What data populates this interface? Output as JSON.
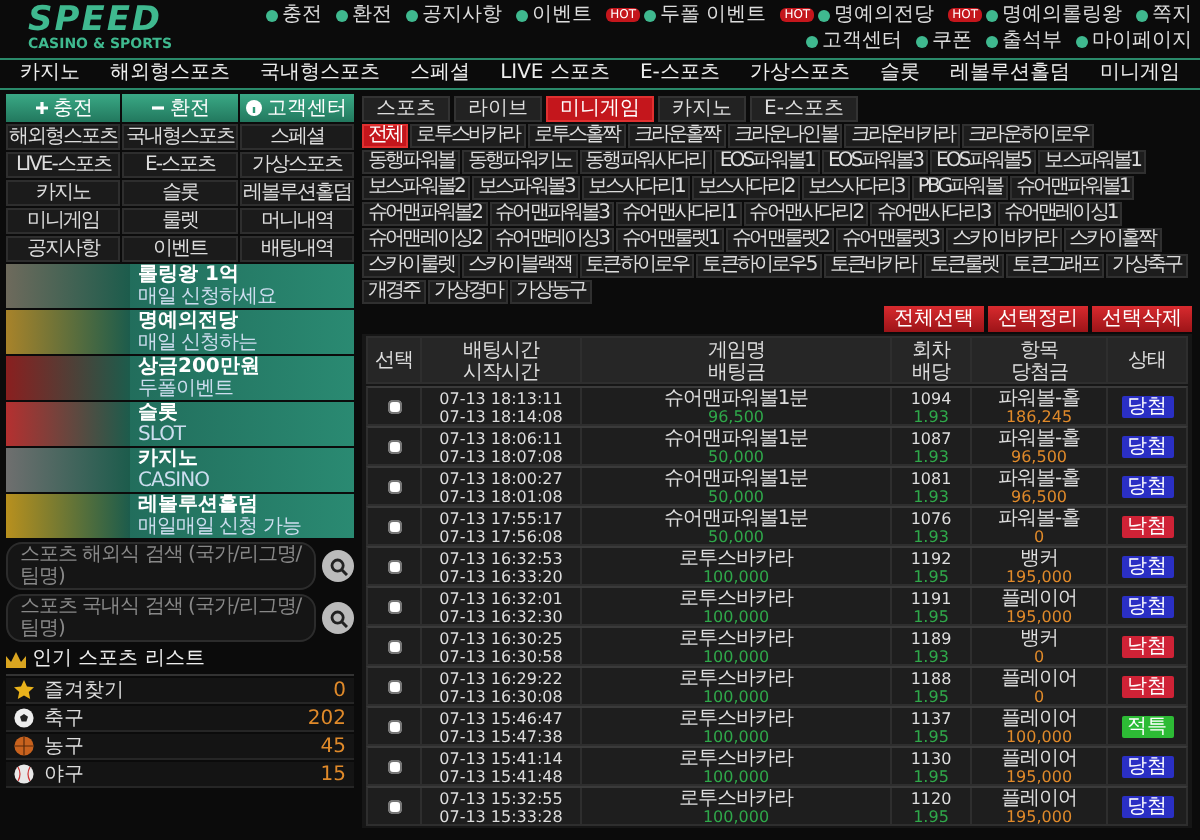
{
  "logo": {
    "title": "SPEED",
    "subtitle": "CASINO & SPORTS"
  },
  "top_links": [
    {
      "label": "충전"
    },
    {
      "label": "환전"
    },
    {
      "label": "공지사항"
    },
    {
      "label": "이벤트"
    },
    {
      "label": "두폴 이벤트",
      "badge": "HOT"
    },
    {
      "label": "명예의전당",
      "badge": "HOT"
    },
    {
      "label": "명예의롤링왕",
      "badge": "HOT"
    },
    {
      "label": "쪽지"
    },
    {
      "label": "고객센터"
    },
    {
      "label": "쿠폰"
    },
    {
      "label": "출석부"
    },
    {
      "label": "마이페이지"
    }
  ],
  "main_nav": [
    "카지노",
    "해외형스포츠",
    "국내형스포츠",
    "스페셜",
    "LIVE 스포츠",
    "E-스포츠",
    "가상스포츠",
    "슬롯",
    "레볼루션홀덤",
    "미니게임"
  ],
  "sidebar": {
    "quick_buttons": [
      "충전",
      "환전",
      "고객센터"
    ],
    "menu": [
      "해외형스포츠",
      "국내형스포츠",
      "스페셜",
      "LIVE-스포츠",
      "E-스포츠",
      "가상스포츠",
      "카지노",
      "슬롯",
      "레볼루션홀덤",
      "미니게임",
      "룰렛",
      "머니내역",
      "공지사항",
      "이벤트",
      "배팅내역"
    ],
    "banners": [
      {
        "title": "롤링왕 1억",
        "subtitle": "매일 신청하세요"
      },
      {
        "title": "명예의전당",
        "subtitle": "매일 신청하는"
      },
      {
        "title": "상금200만원",
        "subtitle": "두폴이벤트"
      },
      {
        "title": "슬롯",
        "subtitle": "SLOT"
      },
      {
        "title": "카지노",
        "subtitle": "CASINO"
      },
      {
        "title": "레볼루션홀덤",
        "subtitle": "매일매일 신청 가능"
      }
    ],
    "searches": [
      {
        "placeholder": "스포츠 해외식 검색 (국가/리그명/팀명)"
      },
      {
        "placeholder": "스포츠 국내식 검색 (국가/리그명/팀명)"
      }
    ],
    "popular": {
      "title": "인기 스포츠 리스트",
      "items": [
        {
          "kind": "favorites",
          "name": "즐겨찾기",
          "count": "0"
        },
        {
          "kind": "soccer",
          "name": "축구",
          "count": "202"
        },
        {
          "kind": "basketball",
          "name": "농구",
          "count": "45"
        },
        {
          "kind": "baseball",
          "name": "야구",
          "count": "15"
        }
      ]
    }
  },
  "category_tabs": [
    {
      "label": "스포츠",
      "selected": false
    },
    {
      "label": "라이브",
      "selected": false
    },
    {
      "label": "미니게임",
      "selected": true
    },
    {
      "label": "카지노",
      "selected": false
    },
    {
      "label": "E-스포츠",
      "selected": false
    }
  ],
  "game_filters": [
    {
      "label": "전체",
      "selected": true
    },
    {
      "label": "로투스바카라",
      "selected": false
    },
    {
      "label": "로투스홀짝",
      "selected": false
    },
    {
      "label": "크라운홀짝",
      "selected": false
    },
    {
      "label": "크라운나인볼",
      "selected": false
    },
    {
      "label": "크라운바카라",
      "selected": false
    },
    {
      "label": "크라운하이로우",
      "selected": false
    },
    {
      "label": "동행파워볼",
      "selected": false
    },
    {
      "label": "동행파워키노",
      "selected": false
    },
    {
      "label": "동행파워사다리",
      "selected": false
    },
    {
      "label": "EOS파워볼1",
      "selected": false
    },
    {
      "label": "EOS파워볼3",
      "selected": false
    },
    {
      "label": "EOS파워볼5",
      "selected": false
    },
    {
      "label": "보스파워볼1",
      "selected": false
    },
    {
      "label": "보스파워볼2",
      "selected": false
    },
    {
      "label": "보스파워볼3",
      "selected": false
    },
    {
      "label": "보스사다리1",
      "selected": false
    },
    {
      "label": "보스사다리2",
      "selected": false
    },
    {
      "label": "보스사다리3",
      "selected": false
    },
    {
      "label": "PBG파워볼",
      "selected": false
    },
    {
      "label": "슈어맨파워볼1",
      "selected": false
    },
    {
      "label": "슈어맨파워볼2",
      "selected": false
    },
    {
      "label": "슈어맨파워볼3",
      "selected": false
    },
    {
      "label": "슈어맨사다리1",
      "selected": false
    },
    {
      "label": "슈어맨사다리2",
      "selected": false
    },
    {
      "label": "슈어맨사다리3",
      "selected": false
    },
    {
      "label": "슈어맨레이싱1",
      "selected": false
    },
    {
      "label": "슈어맨레이싱2",
      "selected": false
    },
    {
      "label": "슈어맨레이싱3",
      "selected": false
    },
    {
      "label": "슈어맨룰렛1",
      "selected": false
    },
    {
      "label": "슈어맨룰렛2",
      "selected": false
    },
    {
      "label": "슈어맨룰렛3",
      "selected": false
    },
    {
      "label": "스카이바카라",
      "selected": false
    },
    {
      "label": "스카이홀짝",
      "selected": false
    },
    {
      "label": "스카이룰렛",
      "selected": false
    },
    {
      "label": "스카이블랙잭",
      "selected": false
    },
    {
      "label": "토큰하이로우",
      "selected": false
    },
    {
      "label": "토큰하이로우5",
      "selected": false
    },
    {
      "label": "토큰바카라",
      "selected": false
    },
    {
      "label": "토큰룰렛",
      "selected": false
    },
    {
      "label": "토큰그래프",
      "selected": false
    },
    {
      "label": "가상축구",
      "selected": false
    },
    {
      "label": "개경주",
      "selected": false
    },
    {
      "label": "가상경마",
      "selected": false
    },
    {
      "label": "가상농구",
      "selected": false
    }
  ],
  "actions": [
    "전체선택",
    "선택정리",
    "선택삭제"
  ],
  "table": {
    "columns": [
      {
        "labels": [
          "선택"
        ]
      },
      {
        "labels": [
          "배팅시간",
          "시작시간"
        ]
      },
      {
        "labels": [
          "게임명",
          "배팅금"
        ]
      },
      {
        "labels": [
          "회차",
          "배당"
        ]
      },
      {
        "labels": [
          "항목",
          "당첨금"
        ]
      },
      {
        "labels": [
          "상태"
        ]
      }
    ],
    "rows": [
      {
        "checked": false,
        "bet_time": "07-13 18:13:11",
        "start_time": "07-13 18:14:08",
        "game": "슈어맨파워볼1분",
        "stake": "96,500",
        "round": "1094",
        "odds": "1.93",
        "pick": "파워볼-홀",
        "payout": "186,245",
        "status": {
          "label": "당첨",
          "color": "#2a2fc4"
        }
      },
      {
        "checked": false,
        "bet_time": "07-13 18:06:11",
        "start_time": "07-13 18:07:08",
        "game": "슈어맨파워볼1분",
        "stake": "50,000",
        "round": "1087",
        "odds": "1.93",
        "pick": "파워볼-홀",
        "payout": "96,500",
        "status": {
          "label": "당첨",
          "color": "#2a2fc4"
        }
      },
      {
        "checked": false,
        "bet_time": "07-13 18:00:27",
        "start_time": "07-13 18:01:08",
        "game": "슈어맨파워볼1분",
        "stake": "50,000",
        "round": "1081",
        "odds": "1.93",
        "pick": "파워볼-홀",
        "payout": "96,500",
        "status": {
          "label": "당첨",
          "color": "#2a2fc4"
        }
      },
      {
        "checked": false,
        "bet_time": "07-13 17:55:17",
        "start_time": "07-13 17:56:08",
        "game": "슈어맨파워볼1분",
        "stake": "50,000",
        "round": "1076",
        "odds": "1.93",
        "pick": "파워볼-홀",
        "payout": "0",
        "status": {
          "label": "낙첨",
          "color": "#cf2236"
        }
      },
      {
        "checked": false,
        "bet_time": "07-13 16:32:53",
        "start_time": "07-13 16:33:20",
        "game": "로투스바카라",
        "stake": "100,000",
        "round": "1192",
        "odds": "1.95",
        "pick": "뱅커",
        "payout": "195,000",
        "status": {
          "label": "당첨",
          "color": "#2a2fc4"
        }
      },
      {
        "checked": false,
        "bet_time": "07-13 16:32:01",
        "start_time": "07-13 16:32:30",
        "game": "로투스바카라",
        "stake": "100,000",
        "round": "1191",
        "odds": "1.95",
        "pick": "플레이어",
        "payout": "195,000",
        "status": {
          "label": "당첨",
          "color": "#2a2fc4"
        }
      },
      {
        "checked": false,
        "bet_time": "07-13 16:30:25",
        "start_time": "07-13 16:30:58",
        "game": "로투스바카라",
        "stake": "100,000",
        "round": "1189",
        "odds": "1.93",
        "pick": "뱅커",
        "payout": "0",
        "status": {
          "label": "낙첨",
          "color": "#cf2236"
        }
      },
      {
        "checked": false,
        "bet_time": "07-13 16:29:22",
        "start_time": "07-13 16:30:08",
        "game": "로투스바카라",
        "stake": "100,000",
        "round": "1188",
        "odds": "1.95",
        "pick": "플레이어",
        "payout": "0",
        "status": {
          "label": "낙첨",
          "color": "#cf2236"
        }
      },
      {
        "checked": false,
        "bet_time": "07-13 15:46:47",
        "start_time": "07-13 15:47:38",
        "game": "로투스바카라",
        "stake": "100,000",
        "round": "1137",
        "odds": "1.95",
        "pick": "플레이어",
        "payout": "100,000",
        "status": {
          "label": "적특",
          "color": "#2dbb35"
        }
      },
      {
        "checked": false,
        "bet_time": "07-13 15:41:14",
        "start_time": "07-13 15:41:48",
        "game": "로투스바카라",
        "stake": "100,000",
        "round": "1130",
        "odds": "1.95",
        "pick": "플레이어",
        "payout": "195,000",
        "status": {
          "label": "당첨",
          "color": "#2a2fc4"
        }
      },
      {
        "checked": false,
        "bet_time": "07-13 15:32:55",
        "start_time": "07-13 15:33:28",
        "game": "로투스바카라",
        "stake": "100,000",
        "round": "1120",
        "odds": "1.95",
        "pick": "플레이어",
        "payout": "195,000",
        "status": {
          "label": "당첨",
          "color": "#2a2fc4"
        }
      }
    ]
  }
}
